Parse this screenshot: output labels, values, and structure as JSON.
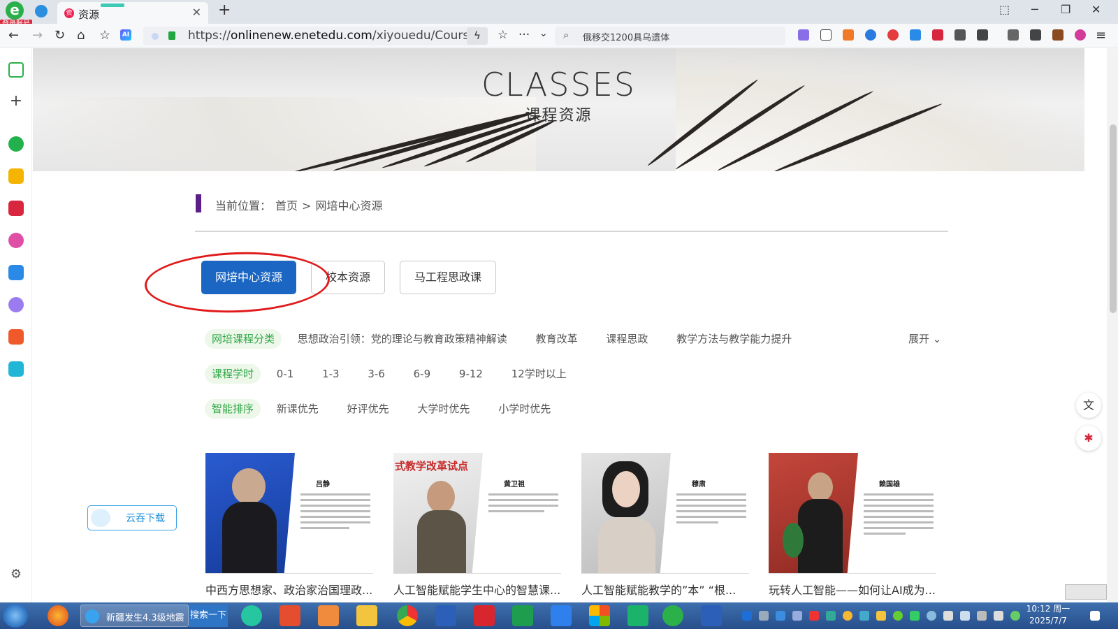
{
  "browser": {
    "tab_title": "资源",
    "tab_favicon": "资",
    "login_badge": "登录账号",
    "url_prefix": "https://",
    "url_domain": "onlinenew.enetedu.com",
    "url_path": "/xiyouedu/Course/I",
    "search_text": "俄移交1200具乌遗体",
    "ai_label": "AI"
  },
  "hero": {
    "title_en": "CLASSES",
    "title_zh": "课程资源"
  },
  "breadcrumb": {
    "prefix": "当前位置：",
    "home": "首页",
    "sep": ">",
    "current": "网培中心资源"
  },
  "resource_tabs": [
    {
      "label": "网培中心资源",
      "active": true
    },
    {
      "label": "校本资源",
      "active": false
    },
    {
      "label": "马工程思政课",
      "active": false
    }
  ],
  "filters": {
    "category": {
      "label": "网培课程分类",
      "items": [
        "思想政治引领：党的理论与教育政策精神解读",
        "教育改革",
        "课程思政",
        "教学方法与教学能力提升"
      ],
      "expand": "展开"
    },
    "hours": {
      "label": "课程学时",
      "items": [
        "0-1",
        "1-3",
        "3-6",
        "6-9",
        "9-12",
        "12学时以上"
      ]
    },
    "sort": {
      "label": "智能排序",
      "items": [
        "新课优先",
        "好评优先",
        "大学时优先",
        "小学时优先"
      ]
    }
  },
  "courses": [
    {
      "name": "吕静",
      "title": "中西方思想家、政治家治国理政...",
      "bg": "#1f49b6"
    },
    {
      "name": "黄卫祖",
      "title": "人工智能赋能学生中心的智慧课...",
      "bg": "#dcdcdc"
    },
    {
      "name": "穆肃",
      "title": "人工智能赋能教学的”本” “根...",
      "bg": "#cfcfcf"
    },
    {
      "name": "赖国雄",
      "title": "玩转人工智能——如何让AI成为...",
      "bg": "#b8322a"
    }
  ],
  "banner_photo_texts": {
    "course_2_overlay": "式教学改革试点"
  },
  "download_button": "云吞下载",
  "taskbar": {
    "window_title": "新疆发生4.3级地震",
    "search_label": "搜索一下",
    "time": "10:12 周一",
    "date": "2025/7/7"
  },
  "colors": {
    "primary_blue": "#1a66c2",
    "accent_green": "#2fa845",
    "purple_marker": "#5b1f8c",
    "annotation_red": "#e01a1a"
  }
}
